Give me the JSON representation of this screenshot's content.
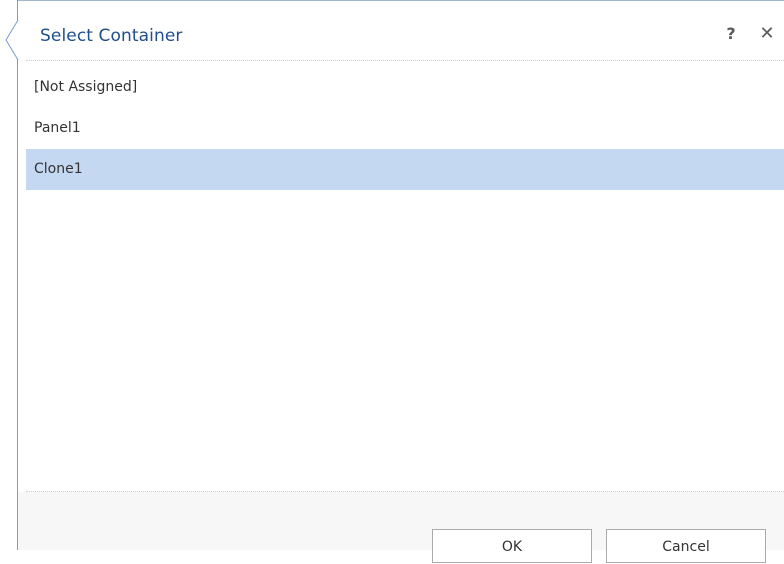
{
  "dialog": {
    "title": "Select Container",
    "help_label": "?",
    "close_label": "✕"
  },
  "list": {
    "items": [
      {
        "label": "[Not Assigned]",
        "selected": false
      },
      {
        "label": "Panel1",
        "selected": false
      },
      {
        "label": "Clone1",
        "selected": true
      }
    ]
  },
  "footer": {
    "ok_label": "OK",
    "cancel_label": "Cancel"
  },
  "colors": {
    "title": "#1f4e8c",
    "selection": "#c5d8f1",
    "border": "#7a9cc6"
  }
}
